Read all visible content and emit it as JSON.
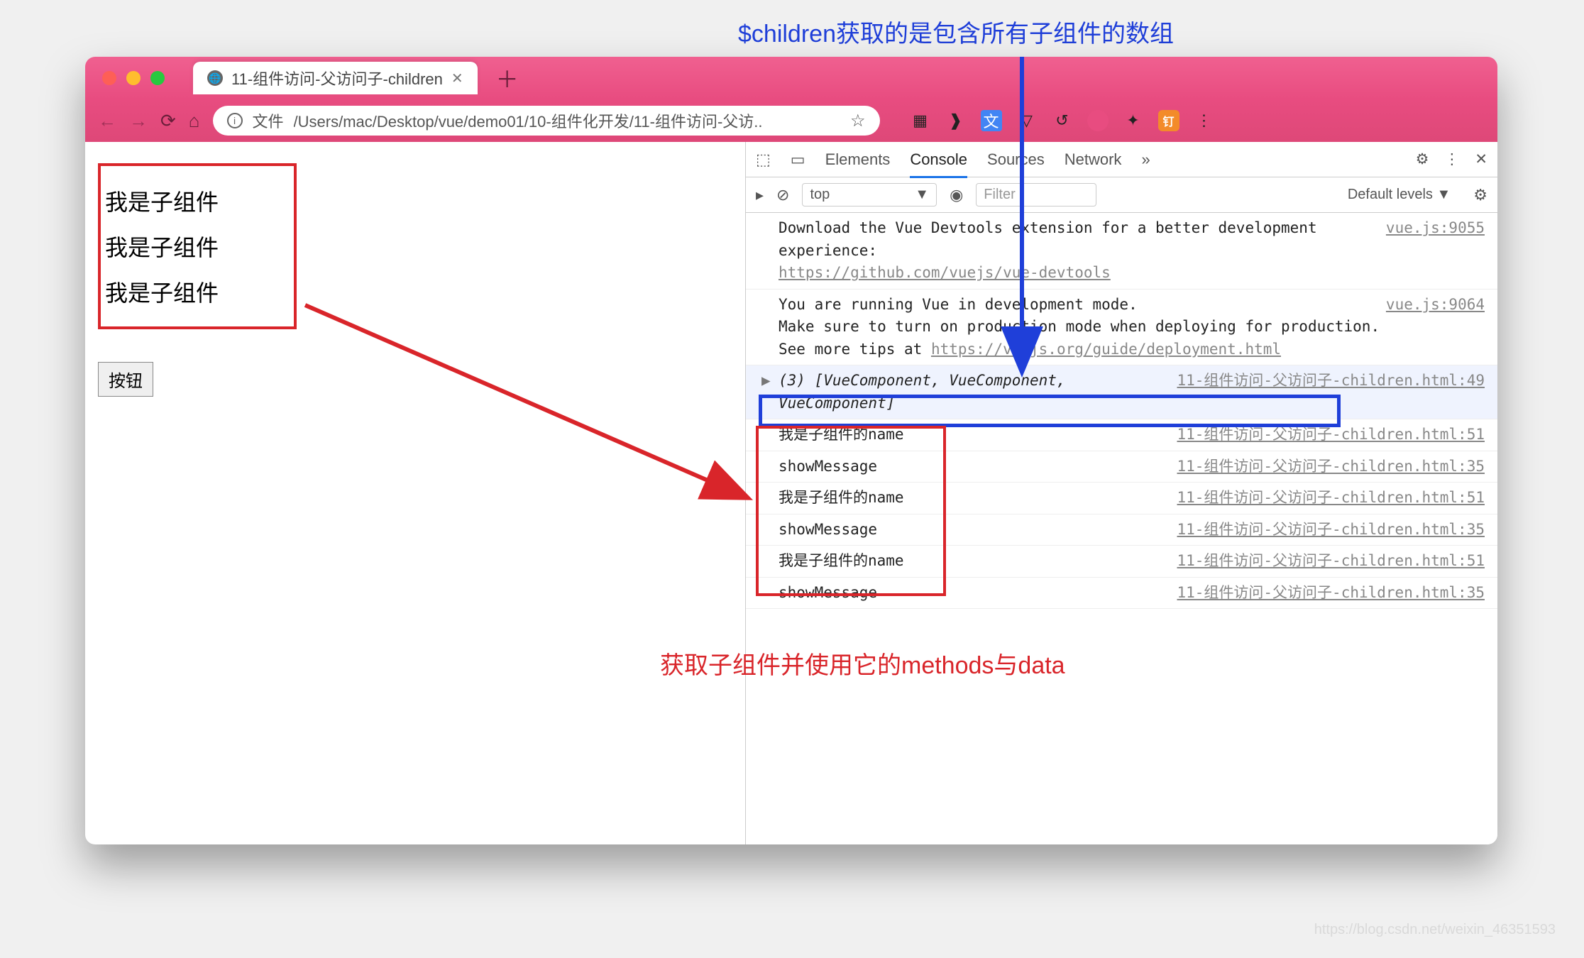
{
  "annotations": {
    "top_blue": "$children获取的是包含所有子组件的数组",
    "bottom_red": "获取子组件并使用它的methods与data"
  },
  "browser": {
    "tab_title": "11-组件访问-父访问子-children",
    "url_label": "文件",
    "url_path": "/Users/mac/Desktop/vue/demo01/10-组件化开发/11-组件访问-父访..",
    "ext_badge": "钉"
  },
  "page": {
    "child_lines": [
      "我是子组件",
      "我是子组件",
      "我是子组件"
    ],
    "button_label": "按钮"
  },
  "devtools": {
    "tabs": [
      "Elements",
      "Console",
      "Sources",
      "Network"
    ],
    "active_tab": "Console",
    "context": "top",
    "filter_placeholder": "Filter",
    "levels": "Default levels ▼",
    "console": [
      {
        "text": "Download the Vue Devtools extension for a better development experience:",
        "link": "https://github.com/vuejs/vue-devtools",
        "src": "vue.js:9055"
      },
      {
        "text": "You are running Vue in development mode.\nMake sure to turn on production mode when deploying for production.\nSee more tips at ",
        "link": "https://vuejs.org/guide/deployment.html",
        "src": "vue.js:9064"
      },
      {
        "arrow": "▶",
        "italic": "(3) [VueComponent, VueComponent, VueComponent]",
        "src": "11-组件访问-父访问子-children.html:49",
        "selected": true
      },
      {
        "plain": "我是子组件的name",
        "src": "11-组件访问-父访问子-children.html:51"
      },
      {
        "plain": "showMessage",
        "src": "11-组件访问-父访问子-children.html:35"
      },
      {
        "plain": "我是子组件的name",
        "src": "11-组件访问-父访问子-children.html:51"
      },
      {
        "plain": "showMessage",
        "src": "11-组件访问-父访问子-children.html:35"
      },
      {
        "plain": "我是子组件的name",
        "src": "11-组件访问-父访问子-children.html:51"
      },
      {
        "plain": "showMessage",
        "src": "11-组件访问-父访问子-children.html:35"
      }
    ]
  },
  "watermark": "https://blog.csdn.net/weixin_46351593"
}
